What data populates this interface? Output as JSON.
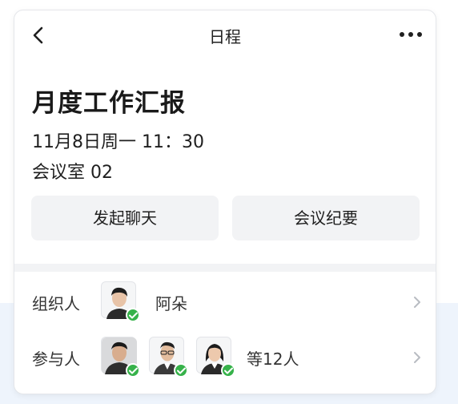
{
  "header": {
    "title": "日程",
    "back_icon": "chevron-left-icon",
    "more_icon": "more-horizontal-icon"
  },
  "event": {
    "title": "月度工作汇报",
    "time": "11月8日周一  11：30",
    "room": "会议室 02"
  },
  "actions": {
    "chat_label": "发起聊天",
    "minutes_label": "会议纪要"
  },
  "organizer": {
    "label": "组织人",
    "name": "阿朵",
    "status": "accepted"
  },
  "participants": {
    "label": "参与人",
    "count_text": "等12人",
    "avatars_shown": 3,
    "status": "accepted"
  },
  "colors": {
    "accept_green": "#36b24a",
    "button_bg": "#f2f3f5",
    "page_bottom_bg": "#eef4fc"
  }
}
